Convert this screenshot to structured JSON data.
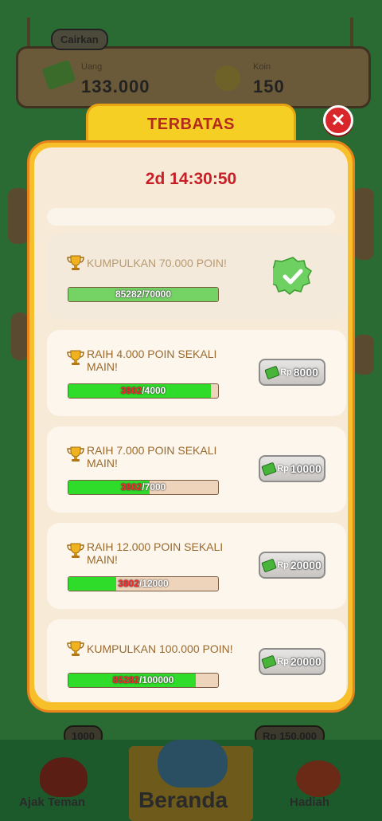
{
  "background": {
    "cashout_label": "Cairkan",
    "balance_label": "Uang",
    "balance_value": "133.000",
    "coins_label": "Koin",
    "coins_value": "150",
    "pill_left": "1000",
    "pill_right": "Rp 150.000",
    "nav": {
      "invite_label": "Ajak Teman",
      "home_label": "Beranda",
      "gift_label": "Hadiah"
    }
  },
  "modal": {
    "title": "TERBATAS",
    "timer": "2d 14:30:50",
    "tasks": [
      {
        "title": "KUMPULKAN 70.000 POIN!",
        "current": "85282",
        "target": "/70000",
        "progress": 1.0,
        "completed": true,
        "reward_currency": "",
        "reward_amount": ""
      },
      {
        "title": "RAIH 4.000 POIN SEKALI MAIN!",
        "current": "3802",
        "target": "/4000",
        "progress": 0.95,
        "completed": false,
        "reward_currency": "Rp",
        "reward_amount": "8000"
      },
      {
        "title": "RAIH 7.000 POIN SEKALI MAIN!",
        "current": "3802",
        "target": "/7000",
        "progress": 0.543,
        "completed": false,
        "reward_currency": "Rp",
        "reward_amount": "10000"
      },
      {
        "title": "RAIH 12.000 POIN SEKALI MAIN!",
        "current": "3802",
        "target": "/12000",
        "progress": 0.317,
        "completed": false,
        "reward_currency": "Rp",
        "reward_amount": "20000"
      },
      {
        "title": "KUMPULKAN 100.000 POIN!",
        "current": "85282",
        "target": "/100000",
        "progress": 0.853,
        "completed": false,
        "reward_currency": "Rp",
        "reward_amount": "20000"
      }
    ]
  },
  "colors": {
    "accent_red": "#c81f26",
    "tab_yellow": "#f6cf24",
    "progress_green": "#2fdc2a"
  },
  "icons": {
    "close": "close-icon",
    "trophy": "trophy-icon",
    "check": "check-badge-icon",
    "cash": "cash-icon"
  }
}
